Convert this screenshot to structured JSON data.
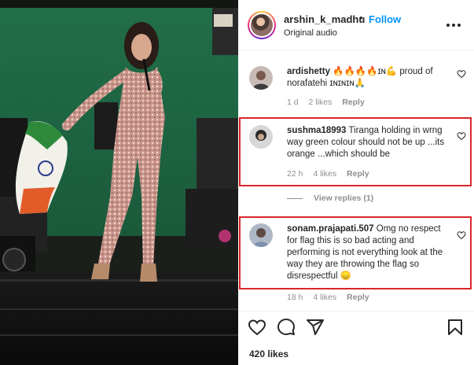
{
  "post": {
    "username": "arshin_k_madhu",
    "separator": "•",
    "follow_label": "Follow",
    "audio_label": "Original audio",
    "likes_text": "420 likes"
  },
  "comments": [
    {
      "username": "ardishetty",
      "text": "🔥🔥🔥🔥ɪɴ💪 proud of norafatehi ɪɴɪɴɪɴ🙏",
      "time": "1 d",
      "likes": "2 likes",
      "reply_label": "Reply",
      "highlighted": false
    },
    {
      "username": "sushma18993",
      "text": "Tiranga holding in wrng way green colour should not be up ...its orange ...which should be",
      "time": "22 h",
      "likes": "4 likes",
      "reply_label": "Reply",
      "highlighted": true
    },
    {
      "username": "sonam.prajapati.507",
      "text": "Omg no respect for flag this is so bad acting and performing is not everything look at the way they are throwing the flag so disrespectful 😞",
      "time": "18 h",
      "likes": "4 likes",
      "reply_label": "Reply",
      "highlighted": true
    }
  ],
  "view_replies_label": "View replies (1)",
  "icons": {
    "more": "more-horizontal-icon",
    "heart": "heart-outline-icon",
    "comment": "comment-bubble-icon",
    "share": "paper-plane-icon",
    "save": "bookmark-icon"
  },
  "colors": {
    "follow_blue": "#0095f6",
    "highlight_red": "#d9262b",
    "muted_text": "#8e8e8e",
    "stage_green": "#1f6b45"
  }
}
